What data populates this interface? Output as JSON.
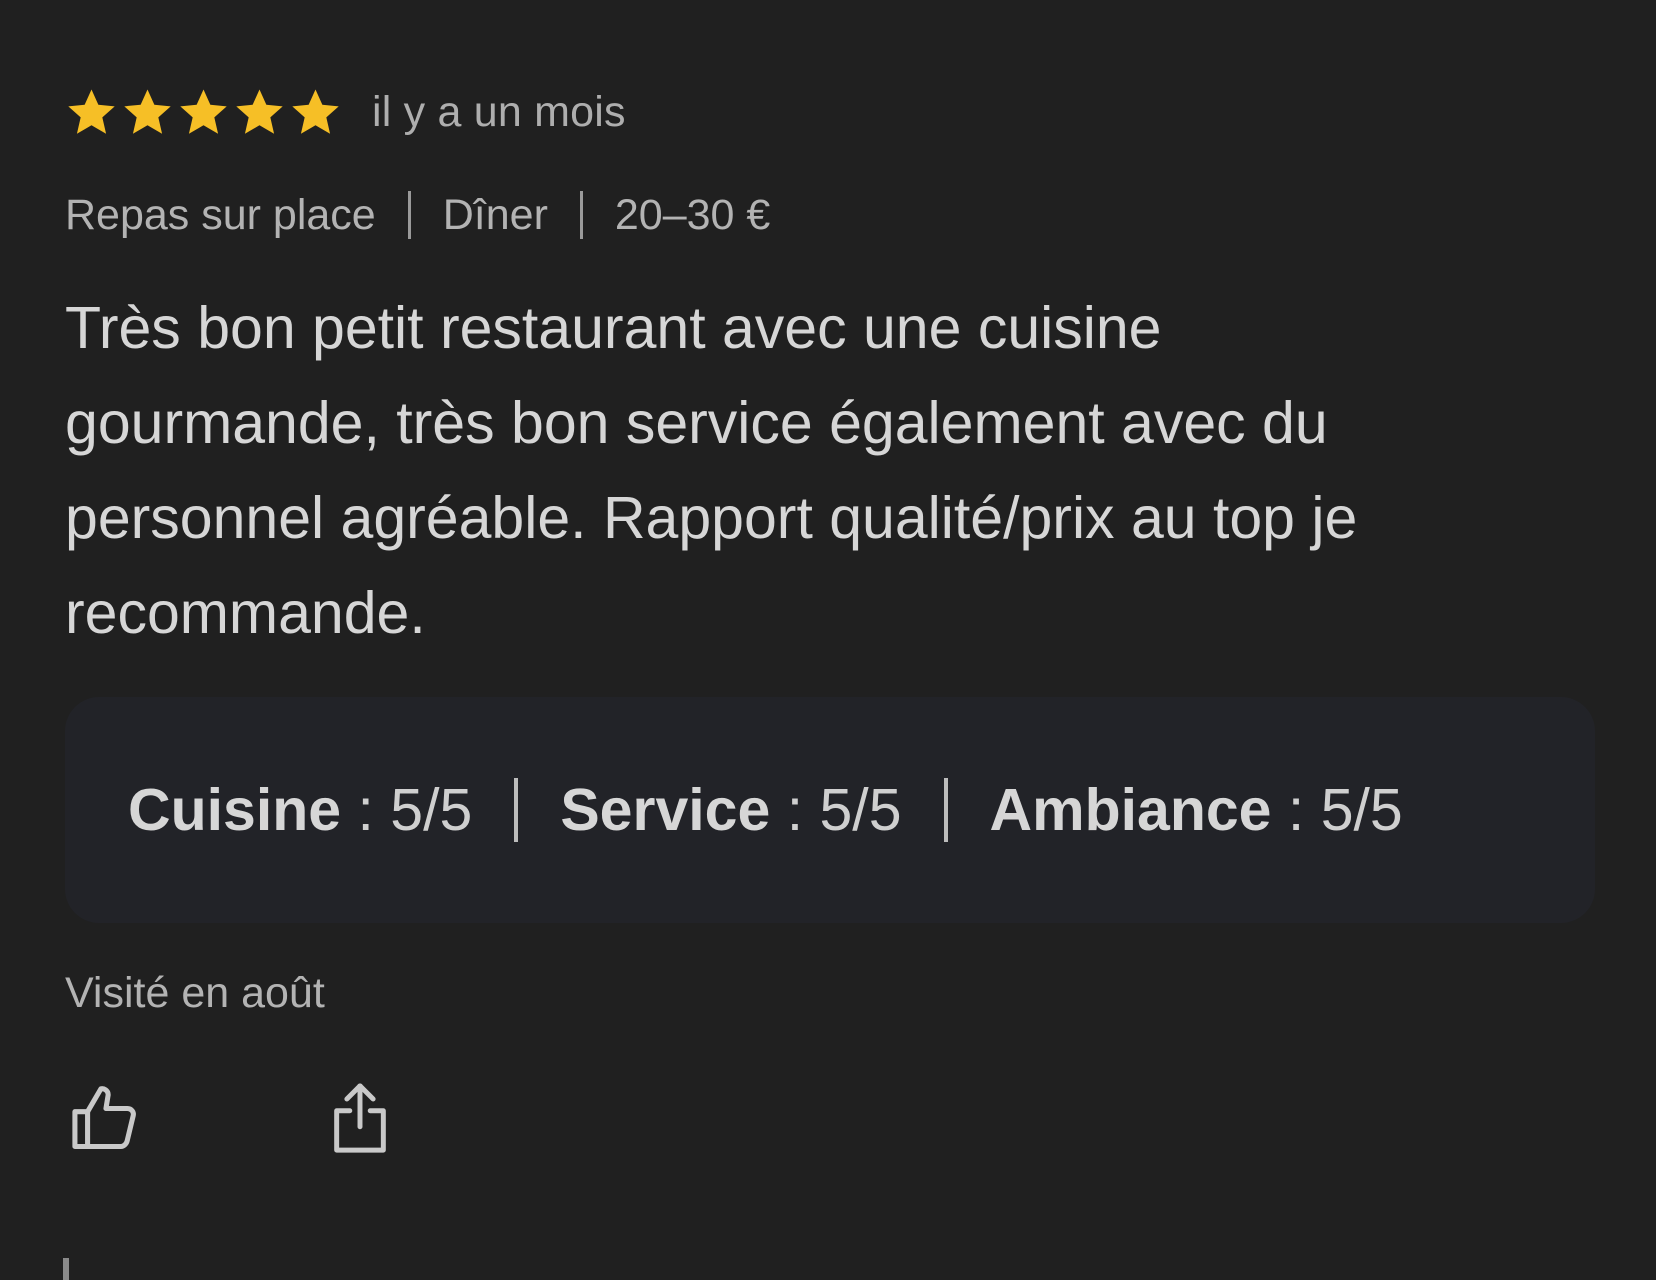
{
  "review": {
    "rating": 5,
    "rating_max": 5,
    "star_color": "#f6bf26",
    "relative_time": "il y a un mois",
    "meta": [
      "Repas sur place",
      "Dîner",
      "20–30 €"
    ],
    "text_lines": [
      "Très bon petit restaurant avec une cuisine",
      "gourmande, très bon service également avec du",
      "personnel agréable. Rapport qualité/prix au top je",
      "recommande."
    ],
    "sub_ratings": [
      {
        "label": "Cuisine",
        "sep": " : ",
        "value": "5/5"
      },
      {
        "label": "Service",
        "sep": " : ",
        "value": "5/5"
      },
      {
        "label": "Ambiance",
        "sep": " : ",
        "value": "5/5"
      }
    ],
    "visited": "Visité en août",
    "actions": {
      "like_icon": "thumbs-up-icon",
      "share_icon": "share-icon"
    }
  }
}
